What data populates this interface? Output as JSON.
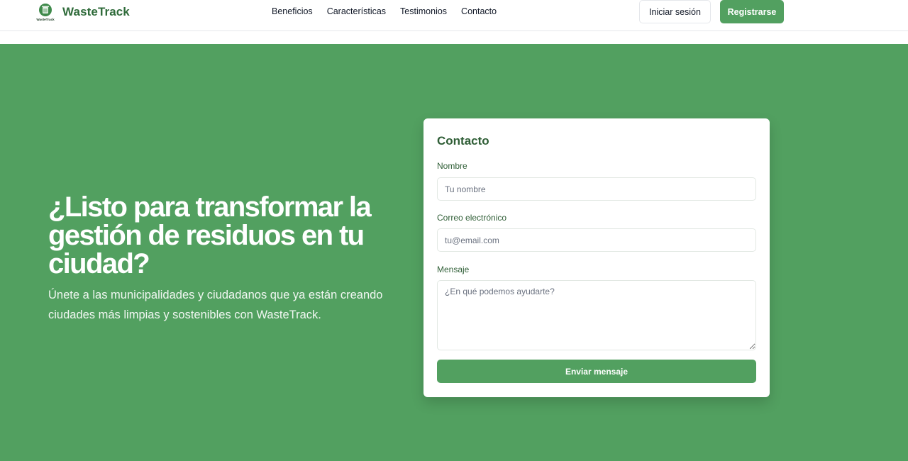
{
  "brand": {
    "name": "WasteTrack",
    "logo_caption": "WasteTrack",
    "color": "#2f6b3a"
  },
  "nav": {
    "items": [
      {
        "label": "Beneficios"
      },
      {
        "label": "Características"
      },
      {
        "label": "Testimonios"
      },
      {
        "label": "Contacto"
      }
    ]
  },
  "header": {
    "login_label": "Iniciar sesión",
    "register_label": "Registrarse"
  },
  "hero": {
    "headline": "¿Listo para transformar la gestión de residuos en tu ciudad?",
    "subtext": "Únete a las municipalidades y ciudadanos que ya están creando ciudades más limpias y sostenibles con WasteTrack.",
    "background_color": "#52a060"
  },
  "contact_form": {
    "title": "Contacto",
    "name_label": "Nombre",
    "name_placeholder": "Tu nombre",
    "email_label": "Correo electrónico",
    "email_placeholder": "tu@email.com",
    "message_label": "Mensaje",
    "message_placeholder": "¿En qué podemos ayudarte?",
    "submit_label": "Enviar mensaje"
  },
  "colors": {
    "accent": "#52a060",
    "heading": "#2f5e36"
  }
}
